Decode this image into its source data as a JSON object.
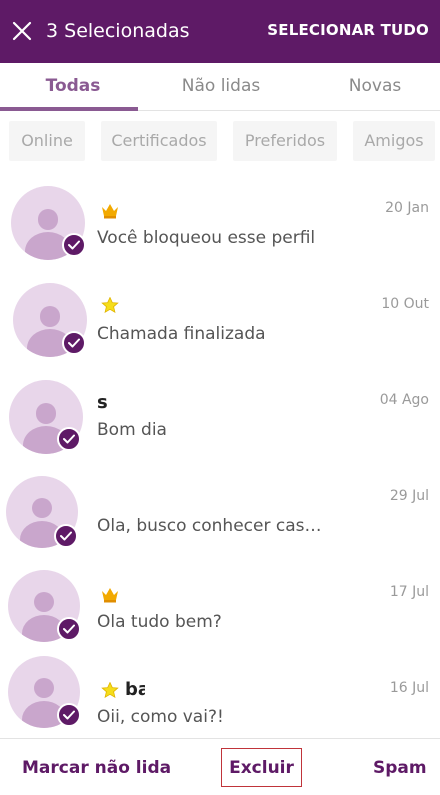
{
  "header": {
    "selected_count_label": "3 Selecionadas",
    "select_all_label": "SELECIONAR TUDO"
  },
  "tabs": [
    {
      "label": "Todas",
      "active": true
    },
    {
      "label": "Não lidas",
      "active": false
    },
    {
      "label": "Novas",
      "active": false
    }
  ],
  "filters": [
    "Online",
    "Certificados",
    "Preferidos",
    "Amigos"
  ],
  "conversations": [
    {
      "badge": "crown-icon",
      "name": "",
      "date": "20 Jan",
      "message": "Você bloqueou esse perfil",
      "selected": true
    },
    {
      "badge": "star-icon",
      "name": "",
      "date": "10 Out",
      "message": "Chamada finalizada",
      "selected": true
    },
    {
      "badge": "",
      "name": "s",
      "date": "04 Ago",
      "message": "Bom dia",
      "selected": true
    },
    {
      "badge": "",
      "name": "",
      "date": "29 Jul",
      "message": "Ola, busco conhecer casai…",
      "selected": true
    },
    {
      "badge": "crown-icon",
      "name": "",
      "date": "17 Jul",
      "message": "Ola tudo bem?",
      "selected": true
    },
    {
      "badge": "star-icon",
      "name": "ba",
      "date": "16 Jul",
      "message": "Oii, como vai?!",
      "selected": true
    }
  ],
  "actions": {
    "mark_unread": "Marcar não lida",
    "delete": "Excluir",
    "spam": "Spam"
  },
  "colors": {
    "primary": "#5e1a66",
    "accent": "#8a5a92",
    "avatar_bg": "#e8d6ea",
    "crown": "#f2a900",
    "star": "#f5dd1a",
    "delete_outline": "#c0343a"
  }
}
